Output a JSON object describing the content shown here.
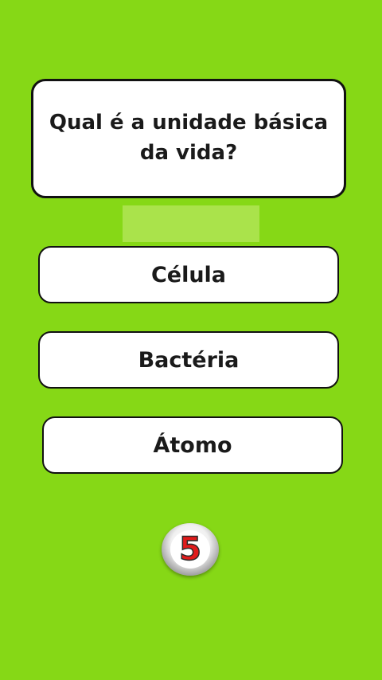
{
  "question": {
    "text": "Qual é a unidade básica da vida?"
  },
  "answers": [
    {
      "label": "Célula"
    },
    {
      "label": "Bactéria"
    },
    {
      "label": "Átomo"
    }
  ],
  "timer": {
    "value": "5"
  },
  "colors": {
    "background": "#86d816",
    "card": "#ffffff",
    "border": "#111111",
    "timer_number": "#e01b1b"
  }
}
